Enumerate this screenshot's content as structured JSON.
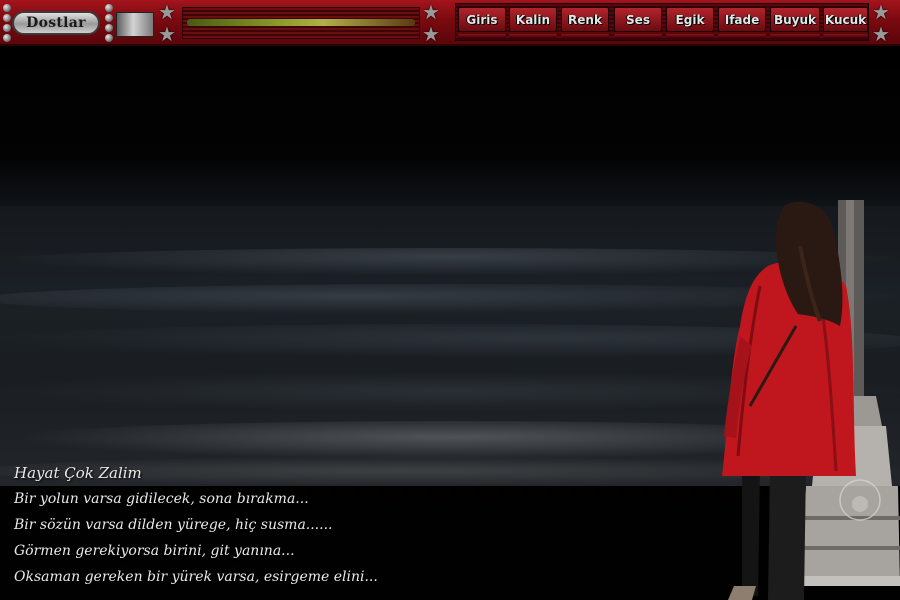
{
  "toolbar": {
    "brand_button": "Dostlar",
    "buttons": [
      "Giris",
      "Kalin",
      "Renk",
      "Ses",
      "Egik",
      "Ifade",
      "Buyuk",
      "Kucuk"
    ],
    "colors": {
      "bar": "#8a0d14",
      "button": "#9e1a22",
      "button_text": "#e4e4e4"
    },
    "icons": [
      "rivet-icon",
      "star-icon"
    ]
  },
  "poem": {
    "title": "Hayat Çok Zalim",
    "lines": [
      "Bir yolun varsa gidilecek, sona bırakma...",
      "Bir sözün varsa dilden yürege, hiç susma......",
      "Görmen gerekiyorsa birini, git yanına...",
      "Oksaman gereken bir yürek varsa, esirgeme elini..."
    ]
  },
  "scene": {
    "description_icons": [
      "woman-red-coat",
      "lamp-post",
      "sea-waves"
    ],
    "coat_color": "#c0161e"
  }
}
